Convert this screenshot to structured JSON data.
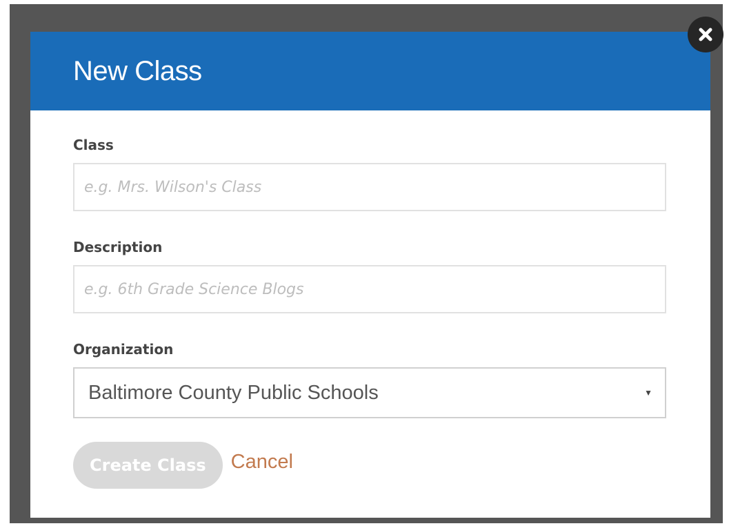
{
  "modal": {
    "title": "New Class",
    "close_icon": "close-icon"
  },
  "form": {
    "class": {
      "label": "Class",
      "value": "",
      "placeholder": "e.g. Mrs. Wilson's Class"
    },
    "description": {
      "label": "Description",
      "value": "",
      "placeholder": "e.g. 6th Grade Science Blogs"
    },
    "organization": {
      "label": "Organization",
      "selected": "Baltimore County Public Schools",
      "caret_icon": "caret-down-icon"
    }
  },
  "actions": {
    "create_label": "Create Class",
    "cancel_label": "Cancel"
  },
  "colors": {
    "header": "#1a6cb8",
    "backdrop": "#555555",
    "create_button_disabled": "#d9d9d9",
    "cancel_link": "#c27a4e"
  }
}
